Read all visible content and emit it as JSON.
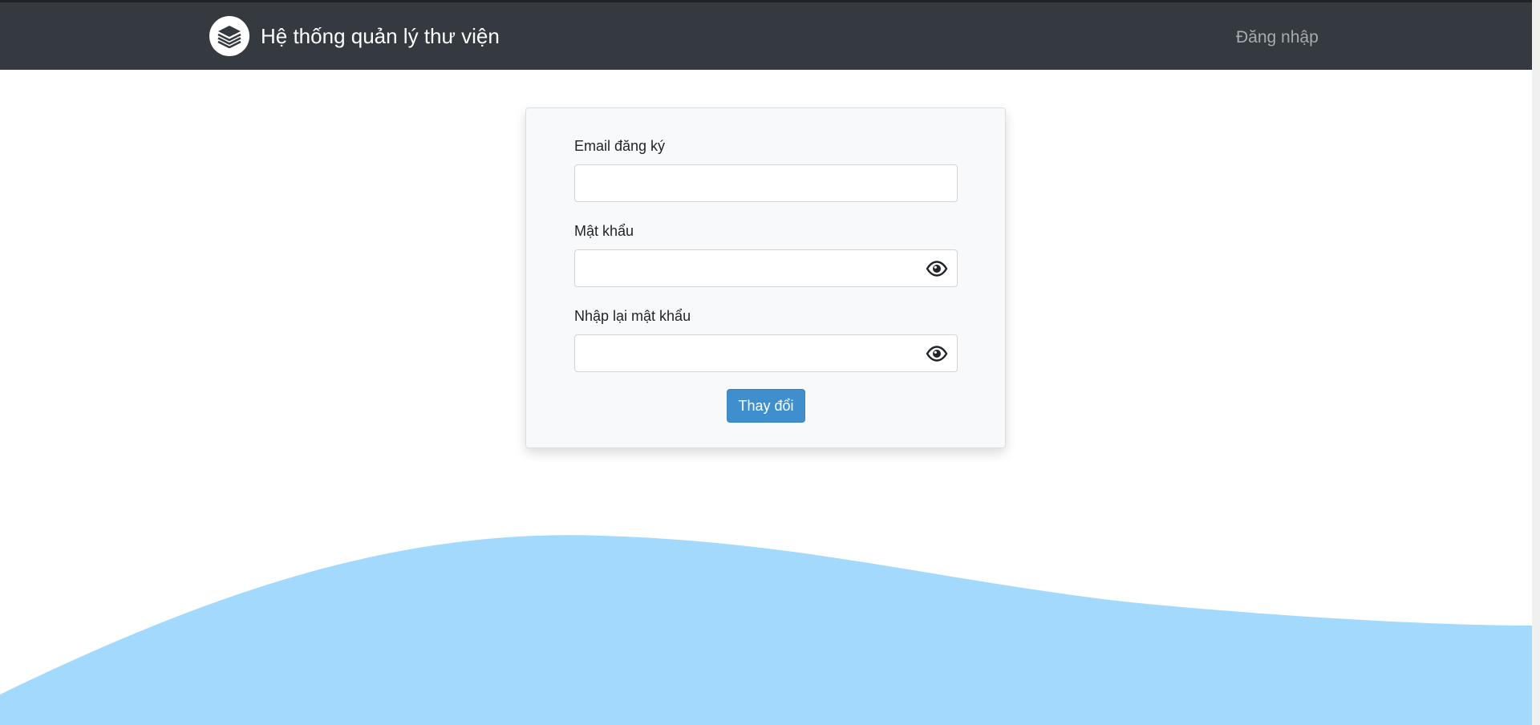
{
  "navbar": {
    "brand_title": "Hệ thống quản lý thư viện",
    "logo_icon": "book-stack-icon",
    "login_link": "Đăng nhập",
    "background": "#343a40"
  },
  "form": {
    "email_label": "Email đăng ký",
    "email_value": "",
    "password_label": "Mật khẩu",
    "password_value": "",
    "confirm_label": "Nhập lại mật khẩu",
    "confirm_value": "",
    "toggle_icon": "eye-icon",
    "submit_label": "Thay đổi",
    "accent": "#3f8fcf"
  },
  "decoration": {
    "wave_color": "#a3d9fc"
  }
}
